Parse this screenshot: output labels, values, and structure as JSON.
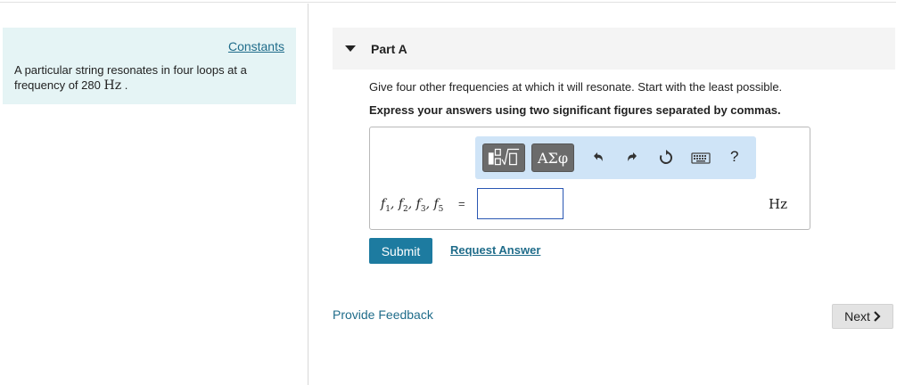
{
  "intro": {
    "constants_link": "Constants",
    "text_prefix": "A particular string resonates in four loops at a frequency of 280",
    "text_unit": "Hz",
    "text_suffix": "."
  },
  "part": {
    "title": "Part A",
    "question": "Give four other frequencies at which it will resonate. Start with the least possible.",
    "instruction": "Express your answers using two significant figures separated by commas."
  },
  "toolbar": {
    "greek_label": "ΑΣφ",
    "help_label": "?",
    "icons": [
      "templates-icon",
      "greek-letters-icon",
      "undo-icon",
      "redo-icon",
      "reset-icon",
      "keyboard-icon",
      "help-icon"
    ]
  },
  "answer": {
    "var_f": "f",
    "subs": [
      "1",
      "2",
      "3",
      "5"
    ],
    "equals": "=",
    "value": "",
    "unit": "Hz"
  },
  "actions": {
    "submit_label": "Submit",
    "request_label": "Request Answer",
    "feedback_label": "Provide Feedback",
    "next_label": "Next"
  },
  "colors": {
    "accent": "#1d7ba0",
    "link": "#1f6c8a",
    "intro_bg": "#e5f4f5",
    "toolbar_bg": "#cfe4f7"
  }
}
